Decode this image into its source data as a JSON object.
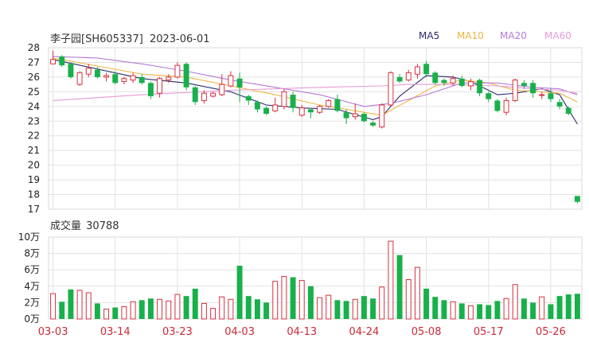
{
  "header": {
    "title": "李子园[SH605337]",
    "date": "2023-06-01",
    "volume_title": "成交量",
    "volume_value": "30788"
  },
  "legend": [
    {
      "label": "MA5",
      "color": "#2b2a6b"
    },
    {
      "label": "MA10",
      "color": "#f0b646"
    },
    {
      "label": "MA20",
      "color": "#b77ad8"
    },
    {
      "label": "MA60",
      "color": "#e59bd9"
    }
  ],
  "colors": {
    "up": "#d6313f",
    "down": "#18b04a",
    "grid": "#e2e2e2",
    "axis_label": "#cc2a36"
  },
  "chart_data": [
    {
      "type": "candlestick",
      "title": "李子园[SH605337]",
      "ylim": [
        17,
        28
      ],
      "y_ticks": [
        28,
        27,
        26,
        25,
        24,
        23,
        22,
        21,
        20,
        19,
        18,
        17
      ],
      "x_ticks": [
        {
          "label": "03-03",
          "index": 0
        },
        {
          "label": "03-14",
          "index": 7
        },
        {
          "label": "03-23",
          "index": 14
        },
        {
          "label": "04-03",
          "index": 21
        },
        {
          "label": "04-13",
          "index": 28
        },
        {
          "label": "04-24",
          "index": 35
        },
        {
          "label": "05-08",
          "index": 42
        },
        {
          "label": "05-17",
          "index": 49
        },
        {
          "label": "05-26",
          "index": 56
        }
      ],
      "candles": [
        [
          26.9,
          27.2,
          27.8,
          26.9
        ],
        [
          27.4,
          26.8,
          27.5,
          26.7
        ],
        [
          26.9,
          26.0,
          27.0,
          25.9
        ],
        [
          25.5,
          26.3,
          26.4,
          25.4
        ],
        [
          26.2,
          26.6,
          26.9,
          26.0
        ],
        [
          26.5,
          26.0,
          26.7,
          25.9
        ],
        [
          26.0,
          26.1,
          26.3,
          25.7
        ],
        [
          26.2,
          25.6,
          26.4,
          25.5
        ],
        [
          25.7,
          25.9,
          26.0,
          25.5
        ],
        [
          25.8,
          26.1,
          26.3,
          25.6
        ],
        [
          26.0,
          25.6,
          26.2,
          25.5
        ],
        [
          25.6,
          24.7,
          25.7,
          24.5
        ],
        [
          24.9,
          25.9,
          26.0,
          24.6
        ],
        [
          25.8,
          26.0,
          26.2,
          25.6
        ],
        [
          26.0,
          26.8,
          27.0,
          25.9
        ],
        [
          26.9,
          25.3,
          27.0,
          25.1
        ],
        [
          25.3,
          24.3,
          25.4,
          24.1
        ],
        [
          24.4,
          24.9,
          25.1,
          24.2
        ],
        [
          24.7,
          24.9,
          25.0,
          24.6
        ],
        [
          24.8,
          25.5,
          26.2,
          24.7
        ],
        [
          25.4,
          26.1,
          26.4,
          25.3
        ],
        [
          25.9,
          25.3,
          26.3,
          24.3
        ],
        [
          24.7,
          24.4,
          24.8,
          24.1
        ],
        [
          24.3,
          23.8,
          24.4,
          23.6
        ],
        [
          23.9,
          23.5,
          24.0,
          23.4
        ],
        [
          23.7,
          24.1,
          24.6,
          23.6
        ],
        [
          24.0,
          25.0,
          25.2,
          23.8
        ],
        [
          24.8,
          23.9,
          25.0,
          23.6
        ],
        [
          23.4,
          23.9,
          24.1,
          23.3
        ],
        [
          23.8,
          23.6,
          23.9,
          23.2
        ],
        [
          23.6,
          24.0,
          24.1,
          23.5
        ],
        [
          24.0,
          24.4,
          24.5,
          23.9
        ],
        [
          24.5,
          23.7,
          24.8,
          23.6
        ],
        [
          23.6,
          23.2,
          23.8,
          22.8
        ],
        [
          23.3,
          23.5,
          24.2,
          23.1
        ],
        [
          23.5,
          23.0,
          23.6,
          22.9
        ],
        [
          22.9,
          22.7,
          23.0,
          22.6
        ],
        [
          22.6,
          24.1,
          24.2,
          22.5
        ],
        [
          24.1,
          26.3,
          26.4,
          24.0
        ],
        [
          26.0,
          25.7,
          26.2,
          25.6
        ],
        [
          25.8,
          26.3,
          26.5,
          25.7
        ],
        [
          26.2,
          26.7,
          26.9,
          25.9
        ],
        [
          26.9,
          26.2,
          27.1,
          26.0
        ],
        [
          26.3,
          25.6,
          26.4,
          25.5
        ],
        [
          25.8,
          25.6,
          25.9,
          25.4
        ],
        [
          25.6,
          25.9,
          26.1,
          25.4
        ],
        [
          25.9,
          25.4,
          26.1,
          25.3
        ],
        [
          25.4,
          25.7,
          25.9,
          25.1
        ],
        [
          25.8,
          24.9,
          25.9,
          24.7
        ],
        [
          24.9,
          24.5,
          25.0,
          24.3
        ],
        [
          24.4,
          23.7,
          24.5,
          23.6
        ],
        [
          23.6,
          24.4,
          24.6,
          23.4
        ],
        [
          24.4,
          25.8,
          25.9,
          24.3
        ],
        [
          25.6,
          25.4,
          25.8,
          25.2
        ],
        [
          25.6,
          24.9,
          25.8,
          24.6
        ],
        [
          24.8,
          24.8,
          25.0,
          24.5
        ],
        [
          24.9,
          24.5,
          25.2,
          24.3
        ],
        [
          24.3,
          24.0,
          24.5,
          23.8
        ],
        [
          23.9,
          23.5,
          24.0,
          23.4
        ],
        [
          17.9,
          17.5,
          17.9,
          17.4
        ]
      ],
      "ma": {
        "MA5": [
          [
            0,
            27.2
          ],
          [
            10,
            25.9
          ],
          [
            15,
            25.6
          ],
          [
            20,
            25.0
          ],
          [
            24,
            24.1
          ],
          [
            28,
            23.9
          ],
          [
            32,
            23.8
          ],
          [
            36,
            23.1
          ],
          [
            37,
            23.3
          ],
          [
            39,
            24.7
          ],
          [
            42,
            26.1
          ],
          [
            45,
            26.0
          ],
          [
            47,
            25.7
          ],
          [
            50,
            24.8
          ],
          [
            52,
            24.9
          ],
          [
            55,
            25.2
          ],
          [
            57,
            24.8
          ],
          [
            59,
            22.8
          ]
        ],
        "MA10": [
          [
            0,
            27.3
          ],
          [
            10,
            26.2
          ],
          [
            15,
            26.0
          ],
          [
            20,
            25.4
          ],
          [
            25,
            24.8
          ],
          [
            30,
            24.1
          ],
          [
            35,
            23.6
          ],
          [
            37,
            23.4
          ],
          [
            40,
            24.4
          ],
          [
            43,
            25.4
          ],
          [
            46,
            25.8
          ],
          [
            49,
            25.6
          ],
          [
            52,
            25.1
          ],
          [
            55,
            25.0
          ],
          [
            57,
            24.9
          ],
          [
            59,
            24.3
          ]
        ],
        "MA20": [
          [
            0,
            27.4
          ],
          [
            5,
            27.3
          ],
          [
            10,
            26.9
          ],
          [
            15,
            26.4
          ],
          [
            20,
            25.8
          ],
          [
            25,
            25.3
          ],
          [
            30,
            24.8
          ],
          [
            35,
            24.0
          ],
          [
            38,
            24.2
          ],
          [
            42,
            24.8
          ],
          [
            46,
            25.6
          ],
          [
            50,
            25.6
          ],
          [
            54,
            25.3
          ],
          [
            57,
            25.2
          ],
          [
            59,
            24.8
          ]
        ],
        "MA60": [
          [
            0,
            24.4
          ],
          [
            10,
            24.8
          ],
          [
            20,
            25.1
          ],
          [
            30,
            25.3
          ],
          [
            37,
            25.4
          ],
          [
            40,
            25.5
          ],
          [
            45,
            25.5
          ],
          [
            50,
            25.4
          ],
          [
            54,
            25.2
          ],
          [
            57,
            25.1
          ],
          [
            59,
            24.9
          ]
        ]
      }
    },
    {
      "type": "bar",
      "title": "成交量",
      "ylim": [
        0,
        100000
      ],
      "y_ticks": [
        {
          "label": "10万",
          "value": 100000
        },
        {
          "label": "8万",
          "value": 80000
        },
        {
          "label": "6万",
          "value": 60000
        },
        {
          "label": "4万",
          "value": 40000
        },
        {
          "label": "2万",
          "value": 20000
        },
        {
          "label": "0万",
          "value": 0
        }
      ],
      "values": [
        31000,
        21000,
        36000,
        35000,
        32000,
        19000,
        12000,
        14000,
        15000,
        21000,
        23000,
        25000,
        24000,
        22000,
        30000,
        28000,
        37000,
        19000,
        13000,
        27000,
        24000,
        65000,
        28000,
        24000,
        20000,
        46000,
        52000,
        51000,
        47000,
        40000,
        26000,
        29000,
        23000,
        22000,
        24000,
        28000,
        25000,
        39000,
        95000,
        78000,
        48000,
        63000,
        37000,
        27000,
        23000,
        21000,
        19000,
        16000,
        18000,
        17000,
        22000,
        25000,
        42000,
        25000,
        20000,
        27000,
        18000,
        28000,
        30000,
        30788
      ]
    }
  ]
}
